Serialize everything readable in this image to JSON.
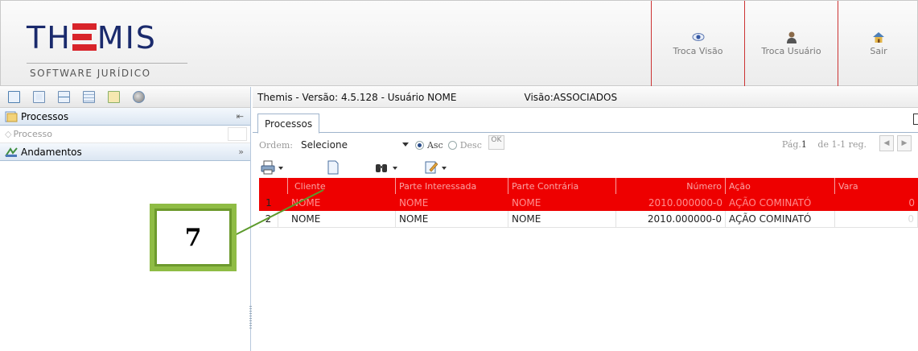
{
  "app": {
    "logo_main_left": "TH",
    "logo_main_right": "MIS",
    "logo_subtitle": "SOFTWARE JURÍDICO"
  },
  "header_buttons": [
    {
      "label": "Troca Visão",
      "icon": "eye-icon"
    },
    {
      "label": "Troca Usuário",
      "icon": "user-icon"
    },
    {
      "label": "Sair",
      "icon": "home-icon"
    }
  ],
  "left_panel": {
    "toolbar_icons": [
      "layout-icon-1",
      "layout-icon-2",
      "layout-icon-3",
      "layout-icon-4",
      "layout-icon-5",
      "round-icon"
    ],
    "processos_header": "Processos",
    "processos_item": "Processo",
    "andamentos_header": "Andamentos",
    "andamentos_expand": "»",
    "processos_collapse": "⇤"
  },
  "right_panel": {
    "title": "Themis - Versão: 4.5.128 - Usuário NOME",
    "visao": "Visão:ASSOCIADOS",
    "tab_label": "Processos",
    "ordem_label": "Ordem:",
    "ordem_value": "Selecione",
    "asc_label": "Asc",
    "desc_label": "Desc",
    "ok_label": "OK",
    "pag_label": "Pág.",
    "pag_value": "1",
    "pag_suffix": "de 1-1 reg.",
    "prev_arrow": "◀",
    "next_arrow": "▶"
  },
  "grid": {
    "columns": [
      "Cliente",
      "Parte Interessada",
      "Parte Contrária",
      "Número",
      "Ação",
      "Vara"
    ],
    "rows": [
      {
        "n": "1",
        "cliente": "NOME",
        "interessada": "NOME",
        "contraria": "NOME",
        "numero": "2010.000000-0",
        "acao": "AÇÃO COMINATÓ",
        "vara": "0"
      },
      {
        "n": "2",
        "cliente": "NOME",
        "interessada": "NOME",
        "contraria": "NOME",
        "numero": "2010.000000-0",
        "acao": "AÇÃO COMINATÓ",
        "vara": "0"
      }
    ]
  },
  "annotation": {
    "label": "7"
  },
  "colors": {
    "accent_red": "#ee0000",
    "annotation_green": "#8fbc45",
    "brand_blue": "#1a2a6c"
  }
}
